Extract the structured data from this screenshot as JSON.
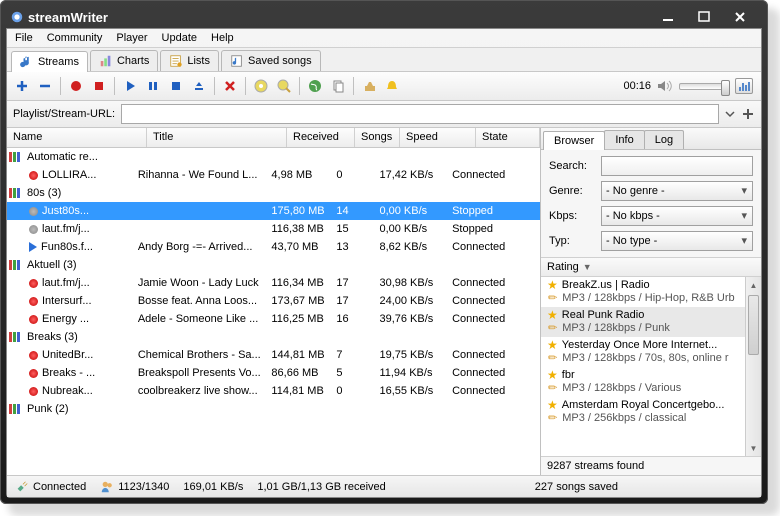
{
  "app_title": "streamWriter",
  "menu": [
    "File",
    "Community",
    "Player",
    "Update",
    "Help"
  ],
  "main_tabs": [
    {
      "label": "Streams",
      "icon": "note",
      "active": true
    },
    {
      "label": "Charts",
      "icon": "chart",
      "active": false
    },
    {
      "label": "Lists",
      "icon": "list",
      "active": false
    },
    {
      "label": "Saved songs",
      "icon": "saved",
      "active": false
    }
  ],
  "toolbar_time": "00:16",
  "url_label": "Playlist/Stream-URL:",
  "url_value": "",
  "columns": {
    "name": "Name",
    "title": "Title",
    "received": "Received",
    "songs": "Songs",
    "speed": "Speed",
    "state": "State"
  },
  "tree": [
    {
      "type": "group",
      "name": "Automatic re...",
      "icon": "rgb"
    },
    {
      "type": "child",
      "dot": "red",
      "name": "LOLLIRA...",
      "title": "Rihanna - We Found L...",
      "recv": "4,98 MB",
      "songs": "0",
      "speed": "17,42 KB/s",
      "state": "Connected"
    },
    {
      "type": "group",
      "name": "80s (3)",
      "icon": "rgb"
    },
    {
      "type": "child",
      "dot": "gray",
      "name": "Just80s...",
      "title": "",
      "recv": "175,80 MB",
      "songs": "14",
      "speed": "0,00 KB/s",
      "state": "Stopped",
      "selected": true
    },
    {
      "type": "child",
      "dot": "gray",
      "name": "laut.fm/j...",
      "title": "",
      "recv": "116,38 MB",
      "songs": "15",
      "speed": "0,00 KB/s",
      "state": "Stopped"
    },
    {
      "type": "child",
      "dot": "blue",
      "name": "Fun80s.f...",
      "title": "Andy Borg -=- Arrived...",
      "recv": "43,70 MB",
      "songs": "13",
      "speed": "8,62 KB/s",
      "state": "Connected"
    },
    {
      "type": "group",
      "name": "Aktuell (3)",
      "icon": "rgb"
    },
    {
      "type": "child",
      "dot": "red",
      "name": "laut.fm/j...",
      "title": "Jamie Woon - Lady Luck",
      "recv": "116,34 MB",
      "songs": "17",
      "speed": "30,98 KB/s",
      "state": "Connected"
    },
    {
      "type": "child",
      "dot": "red",
      "name": "Intersurf...",
      "title": "Bosse feat. Anna Loos...",
      "recv": "173,67 MB",
      "songs": "17",
      "speed": "24,00 KB/s",
      "state": "Connected"
    },
    {
      "type": "child",
      "dot": "red",
      "name": "Energy ...",
      "title": "Adele - Someone Like ...",
      "recv": "116,25 MB",
      "songs": "16",
      "speed": "39,76 KB/s",
      "state": "Connected"
    },
    {
      "type": "group",
      "name": "Breaks (3)",
      "icon": "rgb"
    },
    {
      "type": "child",
      "dot": "red",
      "name": "UnitedBr...",
      "title": "Chemical Brothers - Sa...",
      "recv": "144,81 MB",
      "songs": "7",
      "speed": "19,75 KB/s",
      "state": "Connected"
    },
    {
      "type": "child",
      "dot": "red",
      "name": "Breaks - ...",
      "title": "Breakspoll Presents Vo...",
      "recv": "86,66 MB",
      "songs": "5",
      "speed": "11,94 KB/s",
      "state": "Connected"
    },
    {
      "type": "child",
      "dot": "red",
      "name": "Nubreak...",
      "title": "coolbreakerz live show...",
      "recv": "114,81 MB",
      "songs": "0",
      "speed": "16,55 KB/s",
      "state": "Connected"
    },
    {
      "type": "group",
      "name": "Punk (2)",
      "icon": "rgb"
    }
  ],
  "right_tabs": [
    "Browser",
    "Info",
    "Log"
  ],
  "right_active": 0,
  "filters": {
    "search_label": "Search:",
    "search_value": "",
    "genre_label": "Genre:",
    "genre_value": "- No genre -",
    "kbps_label": "Kbps:",
    "kbps_value": "- No kbps -",
    "typ_label": "Typ:",
    "typ_value": "- No type -"
  },
  "rating_header": "Rating",
  "browser_list": [
    {
      "name": "BreakZ.us | Radio",
      "meta": "MP3 / 128kbps / Hip-Hop, R&B Urb",
      "sel": false
    },
    {
      "name": "Real Punk Radio",
      "meta": "MP3 / 128kbps / Punk",
      "sel": true
    },
    {
      "name": "Yesterday Once More Internet...",
      "meta": "MP3 / 128kbps / 70s, 80s, online r",
      "sel": false
    },
    {
      "name": "fbr",
      "meta": "MP3 / 128kbps / Various",
      "sel": false
    },
    {
      "name": "Amsterdam Royal Concertgebo...",
      "meta": "MP3 / 256kbps / classical",
      "sel": false
    }
  ],
  "found_text": "9287 streams found",
  "status": {
    "connected": "Connected",
    "users": "1123/1340",
    "rate": "169,01 KB/s",
    "recv": "1,01 GB/1,13 GB received",
    "saved": "227 songs saved"
  }
}
